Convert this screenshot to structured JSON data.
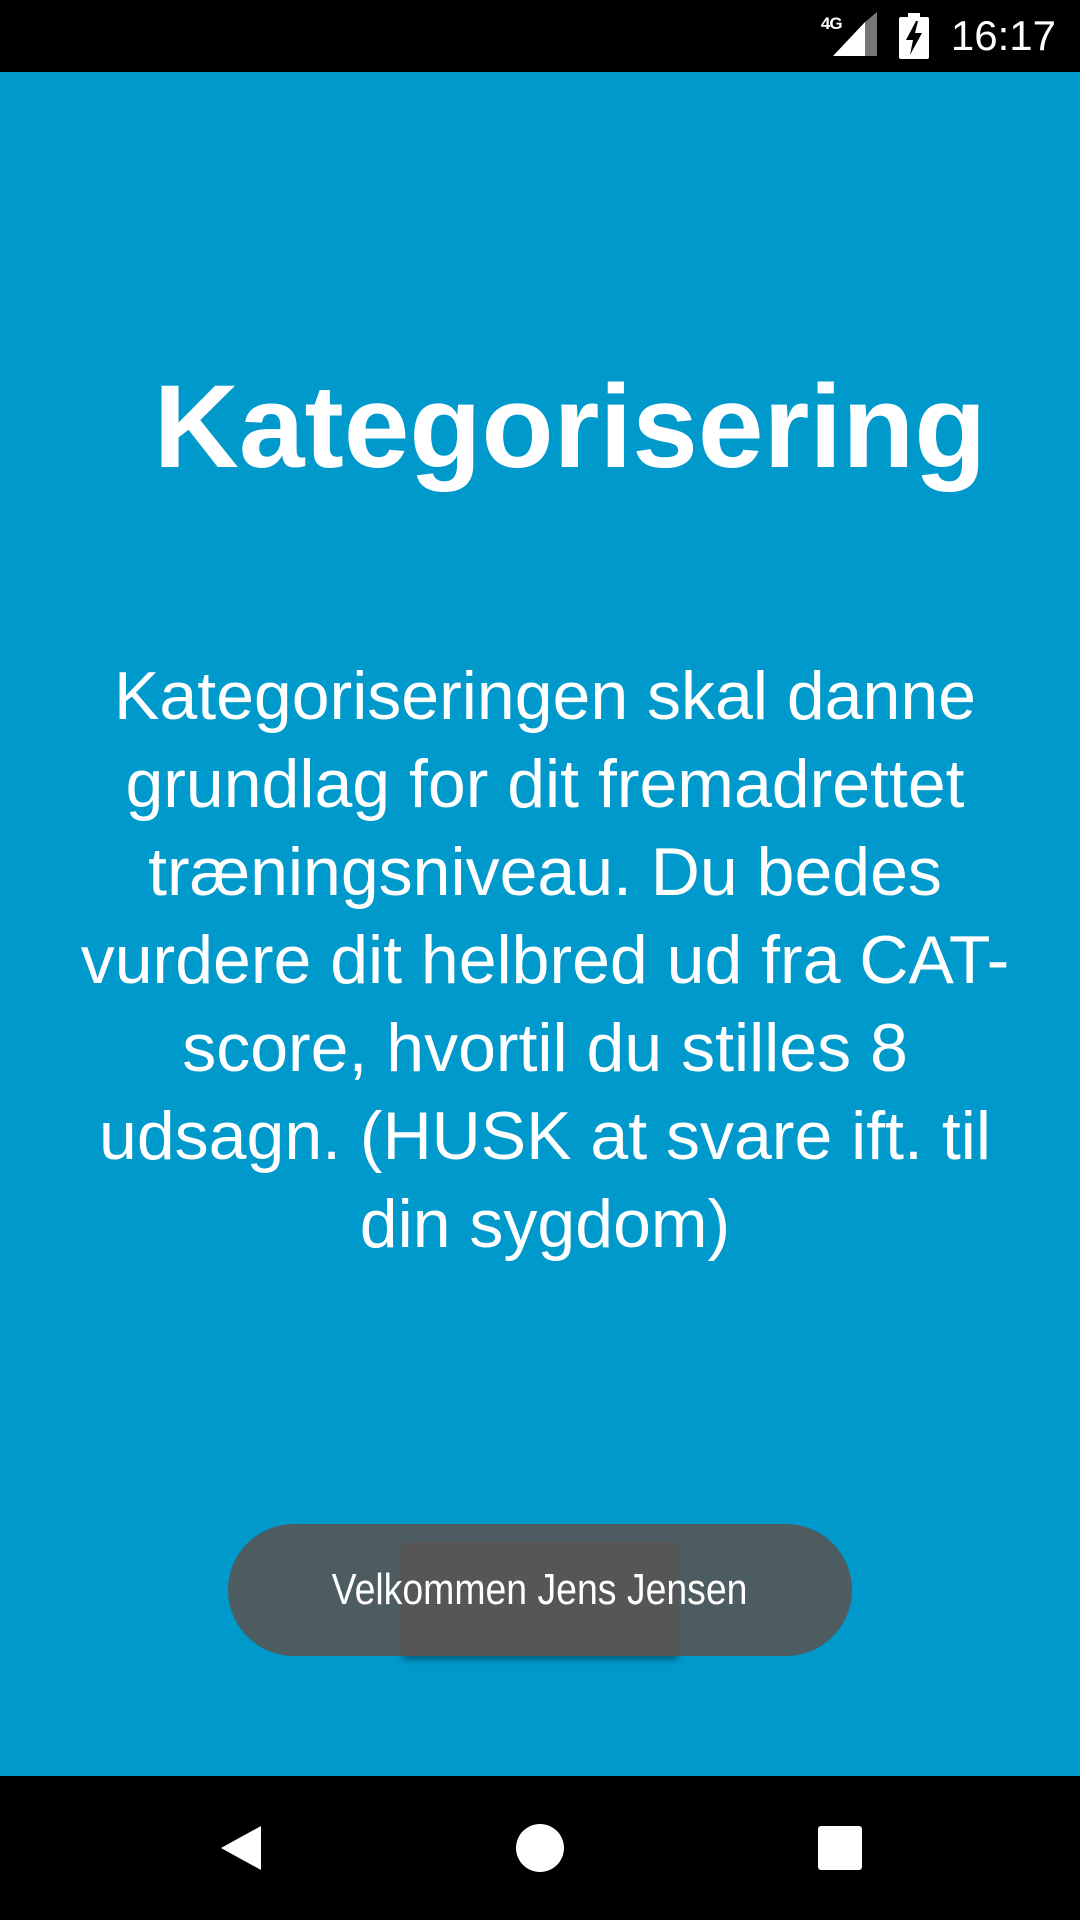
{
  "status_bar": {
    "network": "4G",
    "time": "16:17",
    "icons": [
      "signal-icon",
      "battery-charging-icon"
    ]
  },
  "screen": {
    "title": "Kategorisering",
    "description": "Kategoriseringen skal danne grundlag for dit fremadrettet træningsniveau. Du bedes vurdere dit helbred ud fra CAT-score, hvortil du stilles 8 udsagn. (HUSK at svare ift. til din sygdom)",
    "background_color": "#0099CC"
  },
  "toast": {
    "message": "Velkommen Jens Jensen"
  },
  "nav_bar": {
    "buttons": [
      "back-icon",
      "home-icon",
      "recents-icon"
    ]
  }
}
